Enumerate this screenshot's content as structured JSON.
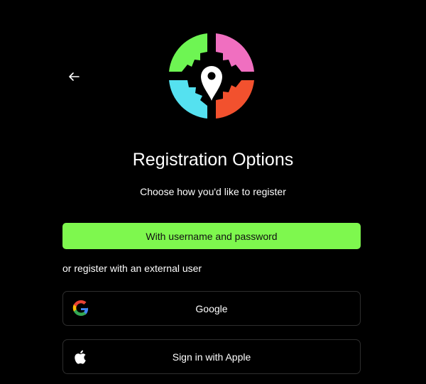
{
  "back": {
    "icon": "arrow-left-icon"
  },
  "logo": {
    "icon": "map-pin-logo"
  },
  "header": {
    "title": "Registration Options",
    "subtitle": "Choose how you'd like to register"
  },
  "primary": {
    "label": "With username and password",
    "color": "#7ef84e"
  },
  "external": {
    "label": "or register with an external user",
    "providers": [
      {
        "label": "Google",
        "icon": "google-icon"
      },
      {
        "label": "Sign in with Apple",
        "icon": "apple-icon"
      }
    ]
  },
  "colors": {
    "background": "#000000",
    "green": "#6ef553",
    "pink": "#f06fc0",
    "cyan": "#55e1f0",
    "orange": "#f2512e"
  }
}
